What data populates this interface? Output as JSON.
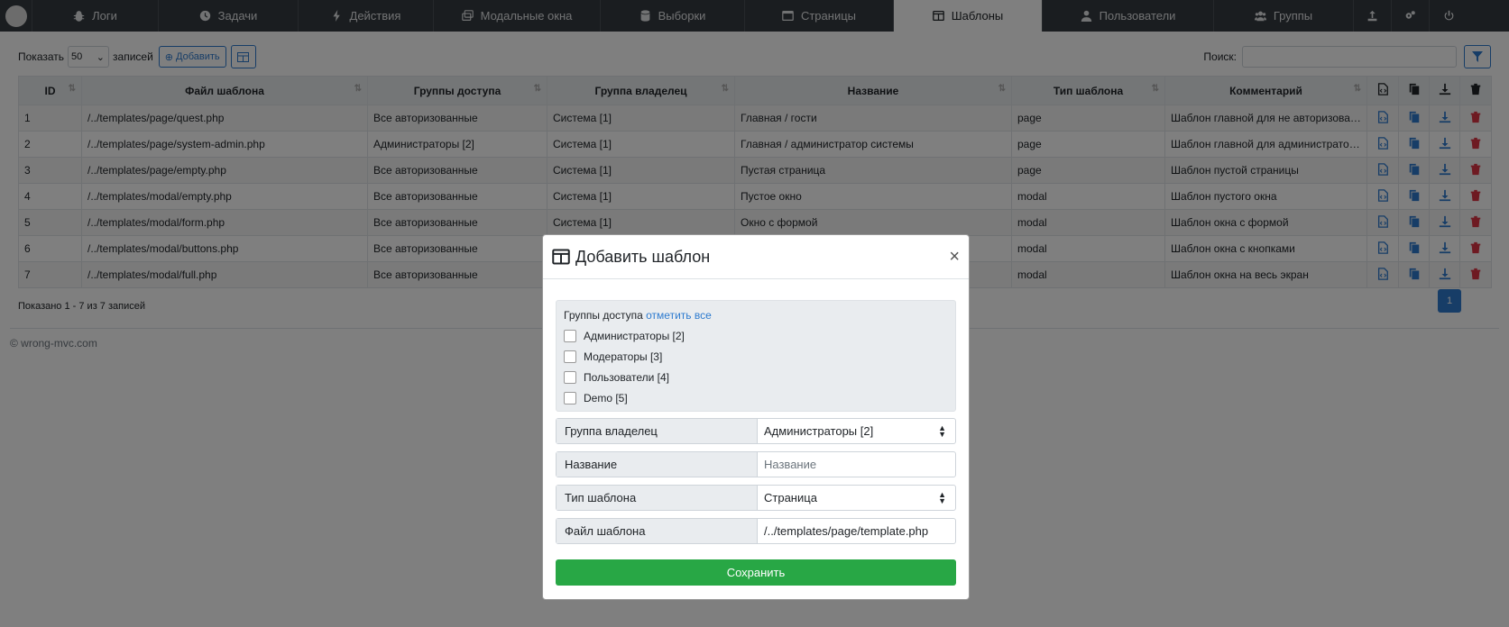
{
  "nav": {
    "tabs": [
      {
        "label": "Логи",
        "icon": "bug-icon"
      },
      {
        "label": "Задачи",
        "icon": "clock-icon"
      },
      {
        "label": "Действия",
        "icon": "bolt-icon"
      },
      {
        "label": "Модальные окна",
        "icon": "windows-icon"
      },
      {
        "label": "Выборки",
        "icon": "database-icon"
      },
      {
        "label": "Страницы",
        "icon": "window-icon"
      },
      {
        "label": "Шаблоны",
        "icon": "columns-icon",
        "active": true
      },
      {
        "label": "Пользователи",
        "icon": "user-icon"
      },
      {
        "label": "Группы",
        "icon": "users-icon"
      }
    ]
  },
  "toolbar": {
    "show_label": "Показать",
    "page_size": "50",
    "records_label": "записей",
    "add_label": "Добавить",
    "search_label": "Поиск:",
    "search_value": ""
  },
  "table": {
    "columns": [
      "ID",
      "Файл шаблона",
      "Группы доступа",
      "Группа владелец",
      "Название",
      "Тип шаблона",
      "Комментарий"
    ],
    "rows": [
      [
        "1",
        "/../templates/page/quest.php",
        "Все авторизованные",
        "Система [1]",
        "Главная / гости",
        "page",
        "Шаблон главной для не авторизованных"
      ],
      [
        "2",
        "/../templates/page/system-admin.php",
        "Администраторы [2]",
        "Система [1]",
        "Главная / администратор системы",
        "page",
        "Шаблон главной для администратора системы"
      ],
      [
        "3",
        "/../templates/page/empty.php",
        "Все авторизованные",
        "Система [1]",
        "Пустая страница",
        "page",
        "Шаблон пустой страницы"
      ],
      [
        "4",
        "/../templates/modal/empty.php",
        "Все авторизованные",
        "Система [1]",
        "Пустое окно",
        "modal",
        "Шаблон пустого окна"
      ],
      [
        "5",
        "/../templates/modal/form.php",
        "Все авторизованные",
        "Система [1]",
        "Окно с формой",
        "modal",
        "Шаблон окна с формой"
      ],
      [
        "6",
        "/../templates/modal/buttons.php",
        "Все авторизованные",
        "",
        "",
        "modal",
        "Шаблон окна с кнопками"
      ],
      [
        "7",
        "/../templates/modal/full.php",
        "Все авторизованные",
        "",
        "",
        "modal",
        "Шаблон окна на весь экран"
      ]
    ]
  },
  "footer": {
    "info": "Показано 1 - 7 из 7 записей",
    "page": "1",
    "copyright": "© wrong-mvc.com"
  },
  "modal": {
    "title": "Добавить шаблон",
    "close": "×",
    "groups_label": "Группы доступа",
    "check_all": "отметить все",
    "groups": [
      "Администраторы [2]",
      "Модераторы [3]",
      "Пользователи [4]",
      "Demo [5]"
    ],
    "owner_label": "Группа владелец",
    "owner_value": "Администраторы [2]",
    "name_label": "Название",
    "name_placeholder": "Название",
    "type_label": "Тип шаблона",
    "type_value": "Страница",
    "file_label": "Файл шаблона",
    "file_value": "/../templates/page/template.php",
    "save_label": "Сохранить"
  }
}
